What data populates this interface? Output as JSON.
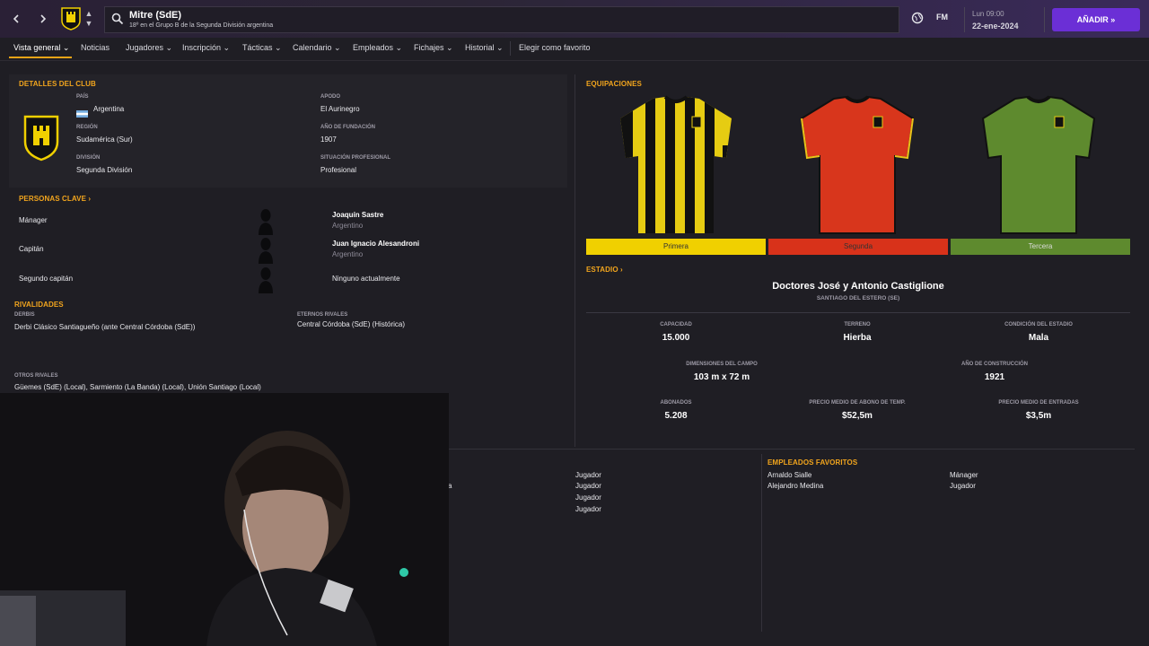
{
  "topbar": {
    "back_icon": "chevron-left-icon",
    "forward_icon": "chevron-right-icon",
    "club_name": "Mitre (SdE)",
    "club_subtitle": "18º en el Grupo B de la Segunda División argentina",
    "fm_label": "FM",
    "time": "Lun 09:00",
    "date": "22-ene-2024",
    "add_button": "AÑADIR »"
  },
  "tabs": [
    {
      "label": "Vista general ⌄"
    },
    {
      "label": "Noticias"
    },
    {
      "label": "Jugadores ⌄"
    },
    {
      "label": "Inscripción ⌄"
    },
    {
      "label": "Tácticas ⌄"
    },
    {
      "label": "Calendario ⌄"
    },
    {
      "label": "Empleados ⌄"
    },
    {
      "label": "Fichajes ⌄"
    },
    {
      "label": "Historial ⌄"
    },
    {
      "label": "Elegir como favorito"
    }
  ],
  "club_details": {
    "title": "DETALLES DEL CLUB",
    "pais_label": "PAÍS",
    "pais": "Argentina",
    "region_label": "REGIÓN",
    "region": "Sudamérica (Sur)",
    "division_label": "DIVISIÓN",
    "division": "Segunda División",
    "apodo_label": "APODO",
    "apodo": "El Aurinegro",
    "fundacion_label": "AÑO DE FUNDACIÓN",
    "fundacion": "1907",
    "situacion_label": "SITUACIÓN PROFESIONAL",
    "situacion": "Profesional"
  },
  "key_people": {
    "title": "PERSONAS CLAVE ›",
    "rows": [
      {
        "role": "Mánager",
        "name": "Joaquín Sastre",
        "nation": "Argentino"
      },
      {
        "role": "Capitán",
        "name": "Juan Ignacio Alesandroni",
        "nation": "Argentino"
      },
      {
        "role": "Segundo capitán",
        "name": "Ninguno actualmente",
        "nation": ""
      }
    ]
  },
  "rivalries": {
    "title": "RIVALIDADES",
    "derbis_label": "DERBIS",
    "derbis": "Derbi Clásico Santiagueño (ante Central Córdoba (SdE))",
    "eternos_label": "ETERNOS RIVALES",
    "eternos": "Central Córdoba (SdE) (Histórica)",
    "otros_label": "OTROS RIVALES",
    "otros": "Güemes (SdE) (Local), Sarmiento (La Banda) (Local), Unión Santiago (Local)"
  },
  "kits": {
    "title": "EQUIPACIONES",
    "items": [
      {
        "label": "Primera",
        "color": "#f0d000"
      },
      {
        "label": "Segunda",
        "color": "#d8321a"
      },
      {
        "label": "Tercera",
        "color": "#5e8a2e"
      }
    ]
  },
  "stadium": {
    "title": "ESTADIO ›",
    "name": "Doctores José y Antonio Castiglione",
    "location": "SANTIAGO DEL ESTERO (SE)",
    "capacidad_label": "CAPACIDAD",
    "capacidad": "15.000",
    "terreno_label": "TERRENO",
    "terreno": "Hierba",
    "condicion_label": "CONDICIÓN DEL ESTADIO",
    "condicion": "Mala",
    "dimensiones_label": "DIMENSIONES DEL CAMPO",
    "dimensiones": "103 m x 72 m",
    "construccion_label": "AÑO DE CONSTRUCCIÓN",
    "construccion": "1921",
    "abonados_label": "ABONADOS",
    "abonados": "5.208",
    "abono_label": "PRECIO MEDIO DE ABONO DE TEMP.",
    "abono": "$52,5m",
    "entradas_label": "PRECIO MEDIO DE ENTRADAS",
    "entradas": "$3,5m"
  },
  "bottom_left": {
    "partial_text": "a",
    "roles": [
      "Jugador",
      "Jugador",
      "Jugador",
      "Jugador"
    ]
  },
  "favorite_staff": {
    "title": "EMPLEADOS FAVORITOS",
    "rows": [
      {
        "name": "Arnaldo Sialle",
        "role": "Mánager"
      },
      {
        "name": "Alejandro Medina",
        "role": "Jugador"
      }
    ]
  },
  "colors": {
    "accent": "#f2a51d",
    "add_button": "#6b2fd6"
  }
}
